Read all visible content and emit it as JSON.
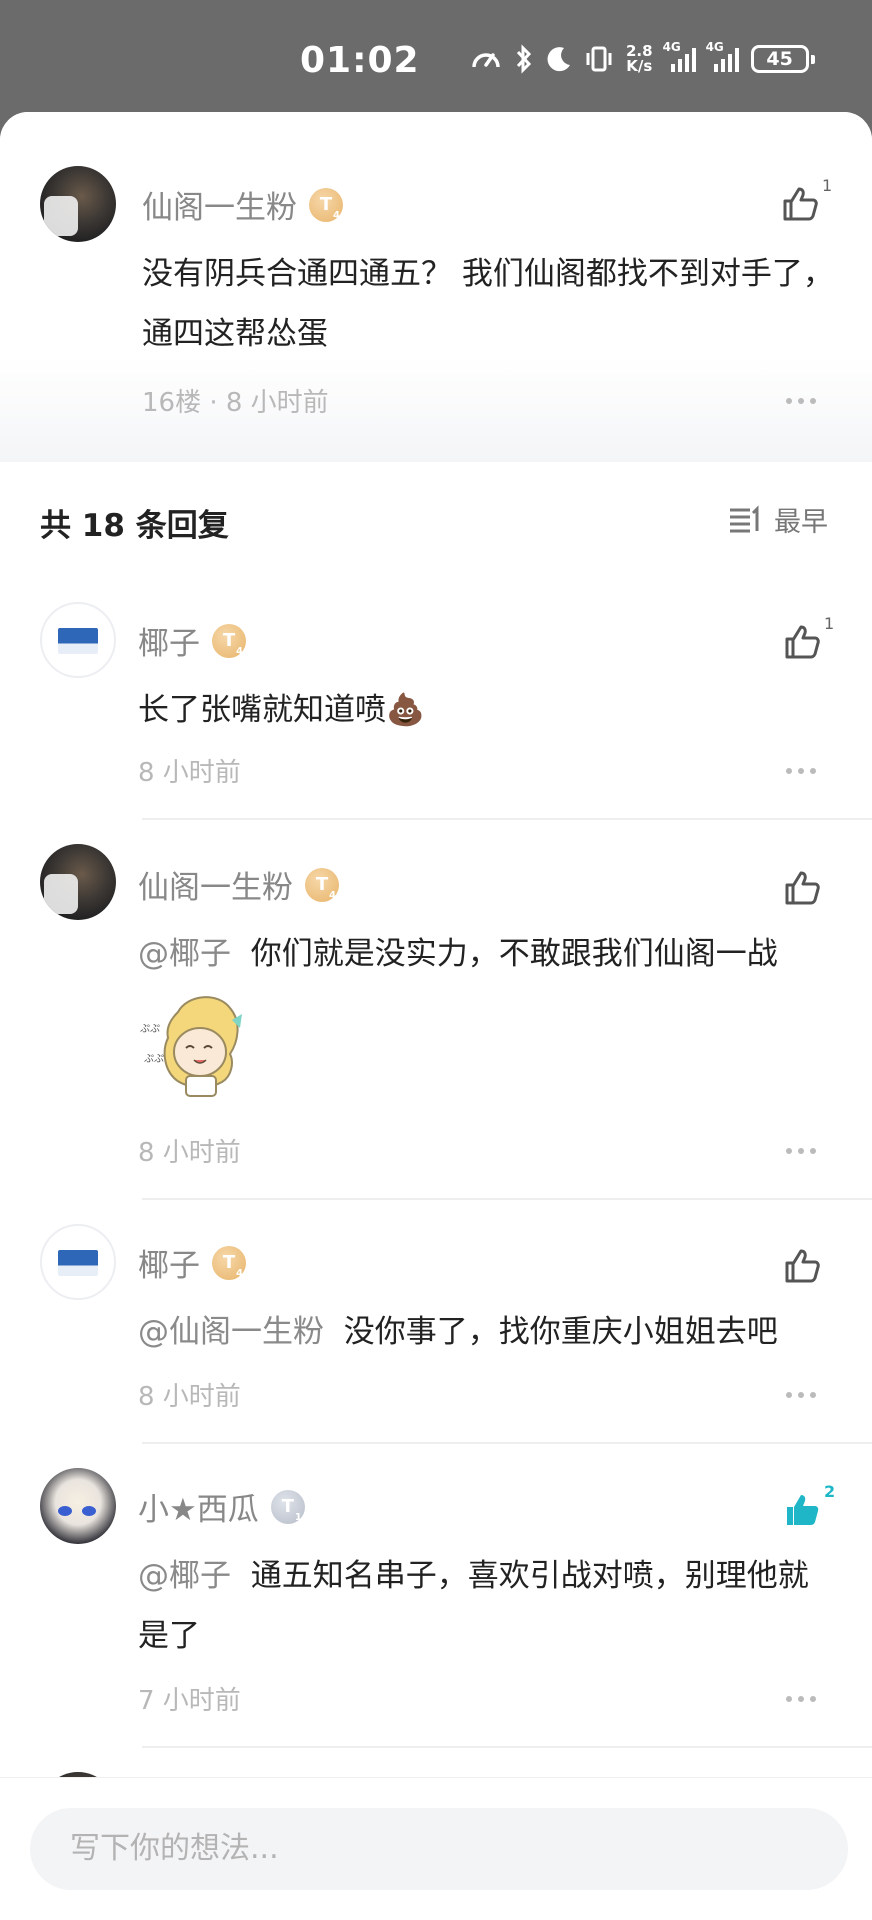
{
  "status_bar": {
    "time": "01:02",
    "net_speed_top": "2.8",
    "net_speed_bottom": "K/s",
    "network_1": "4G",
    "network_2": "4G",
    "battery": "45"
  },
  "main_comment": {
    "username": "仙阁一生粉",
    "badge": "T",
    "badge_level": "4",
    "text": "没有阴兵合通四通五？ 我们仙阁都找不到对手了，通四这帮怂蛋",
    "meta": "16楼 · 8 小时前",
    "likes": "1"
  },
  "replies_header": {
    "title": "共 18 条回复",
    "sort_label": "最早"
  },
  "replies": [
    {
      "username": "椰子",
      "badge": "T",
      "badge_level": "4",
      "mention": "",
      "text": "长了张嘴就知道喷💩",
      "time": "8 小时前",
      "likes": "1"
    },
    {
      "username": "仙阁一生粉",
      "badge": "T",
      "badge_level": "4",
      "mention": "@椰子",
      "text": "你们就是没实力，不敢跟我们仙阁一战",
      "time": "8 小时前",
      "likes": ""
    },
    {
      "username": "椰子",
      "badge": "T",
      "badge_level": "4",
      "mention": "@仙阁一生粉",
      "text": "没你事了，找你重庆小姐姐去吧",
      "time": "8 小时前",
      "likes": ""
    },
    {
      "username": "小★西瓜",
      "badge": "T",
      "badge_level": "1",
      "mention": "@椰子",
      "text": "通五知名串子，喜欢引战对喷，别理他就是了",
      "time": "7 小时前",
      "likes": "2"
    }
  ],
  "composer": {
    "placeholder": "写下你的想法..."
  },
  "colors": {
    "accent_liked": "#1fb7c7",
    "badge_gold": "#e8b46a",
    "badge_silver": "#b6bdc9",
    "status_bar_bg": "#6b6b6b"
  }
}
